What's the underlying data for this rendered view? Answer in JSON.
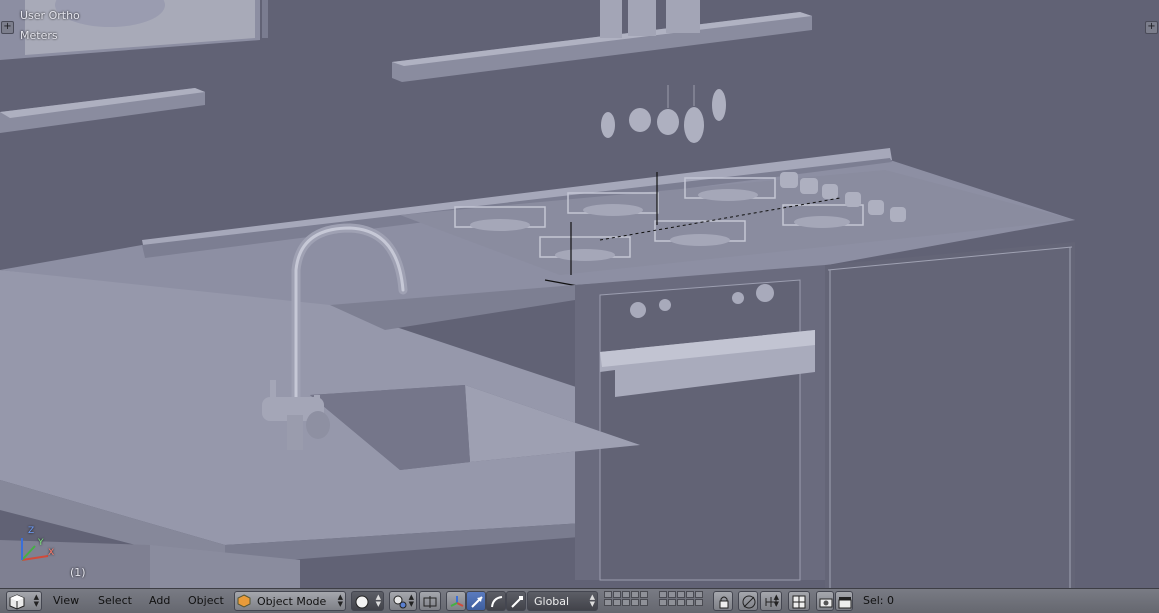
{
  "viewport": {
    "view_name": "User Ortho",
    "units": "Meters",
    "frame_label": "(1)",
    "axis_labels": {
      "x": "X",
      "y": "Y",
      "z": "Z"
    }
  },
  "header": {
    "menus": [
      "View",
      "Select",
      "Add",
      "Object"
    ],
    "mode": "Object Mode",
    "transform_orientation": "Global",
    "selection_status": "Sel: 0"
  },
  "icons": {
    "editor_type": "cube-icon",
    "viewport_shading": "solid-sphere-icon",
    "pivot": "pivot-icon",
    "manipulator_toggle": "manipulator-icon",
    "translate": "translate-arrow-icon",
    "rotate": "rotate-arc-icon",
    "scale": "scale-icon",
    "lock_camera": "lock-icon",
    "proportional_editing": "proportional-icon",
    "snap": "magnet-icon",
    "snap_target": "snap-target-icon",
    "render_still": "camera-icon",
    "render_anim": "clapper-icon"
  },
  "colors": {
    "viewport_bg": "#616275",
    "header_bg": "#72747c",
    "active_button": "#4e6eae"
  }
}
